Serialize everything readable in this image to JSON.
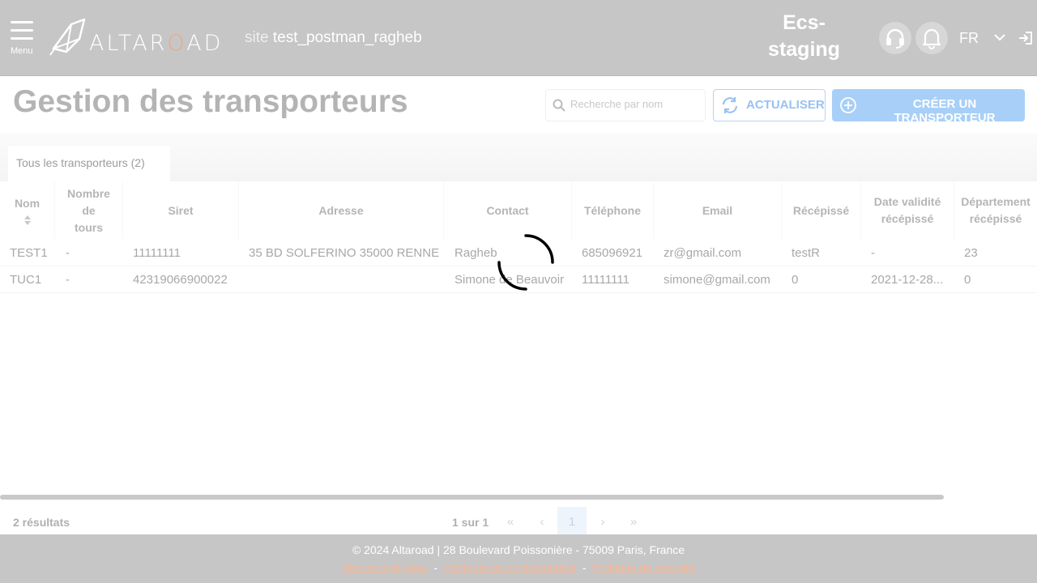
{
  "header": {
    "menu_label": "Menu",
    "logo_text_pre": "ALTAR",
    "logo_text_o": "O",
    "logo_text_post": "AD",
    "site_prefix": "site",
    "site_name": "test_postman_ragheb",
    "environment_line1": "Ecs-",
    "environment_line2": "staging",
    "language": "FR"
  },
  "page": {
    "title": "Gestion des transporteurs",
    "search_placeholder": "Recherche par nom",
    "refresh_label": "ACTUALISER",
    "create_label": "CRÉER UN TRANSPORTEUR"
  },
  "tabs": [
    {
      "label": "Tous les transporteurs (2)"
    }
  ],
  "table": {
    "columns": [
      {
        "label": "Nom"
      },
      {
        "label_lines": [
          "Nombre",
          "de",
          "tours"
        ]
      },
      {
        "label": "Siret"
      },
      {
        "label": "Adresse"
      },
      {
        "label": "Contact"
      },
      {
        "label": "Téléphone"
      },
      {
        "label": "Email"
      },
      {
        "label": "Récépissé"
      },
      {
        "label_lines": [
          "Date validité",
          "récépissé"
        ]
      },
      {
        "label_lines": [
          "Département",
          "récépissé"
        ]
      }
    ],
    "rows": [
      {
        "nom": "TEST1",
        "tours": "-",
        "siret": "11111111",
        "adresse": "35 BD SOLFERINO 35000 RENNES",
        "contact": "Ragheb",
        "telephone": "685096921",
        "email": "zr@gmail.com",
        "recepisse": "testR",
        "date_validite": "-",
        "departement": "23"
      },
      {
        "nom": "TUC1",
        "tours": "-",
        "siret": "42319066900022",
        "adresse": "",
        "contact": "Simone de Beauvoir",
        "telephone": "11111111",
        "email": "simone@gmail.com",
        "recepisse": "0",
        "date_validite": "2021-12-28...",
        "departement": "0"
      }
    ]
  },
  "pagination": {
    "results": "2 résultats",
    "page_info": "1 sur 1",
    "current_page": "1",
    "first": "«",
    "prev": "‹",
    "next": "›",
    "last": "»"
  },
  "footer": {
    "copyright": "© 2024 Altaroad | 28 Boulevard Poissonière - 75009 Paris, France",
    "link_legal": "Mentions légales",
    "link_privacy": "Politique de confidentialité",
    "link_security": "Politique de sécurité",
    "separator": "-"
  },
  "colors": {
    "header_bg": "#c6c6c6",
    "accent_blue": "#a8cff7",
    "footer_link": "#f3b89b"
  }
}
